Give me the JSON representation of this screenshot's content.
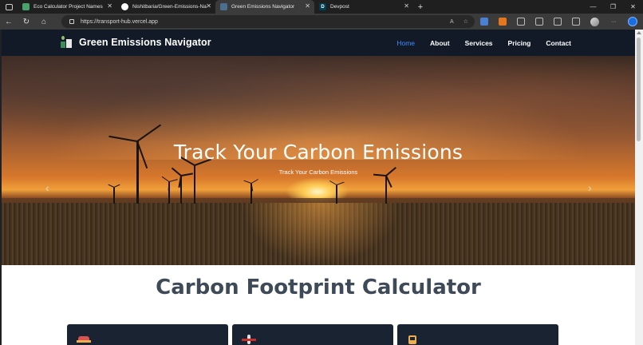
{
  "browser": {
    "tabs": [
      {
        "title": "Eco Calculator Project Names",
        "favicon_color": "#4aa26b"
      },
      {
        "title": "Nishitbaria/Green-Emissions-Na",
        "favicon_color": "#ffffff"
      },
      {
        "title": "Green Emissions Navigator",
        "favicon_color": "#4b6f8f"
      },
      {
        "title": "Devpost",
        "favicon_color": "#003e54",
        "favicon_letter": "D"
      }
    ],
    "active_tab": 2,
    "url": "https://transport-hub.vercel.app"
  },
  "site": {
    "brand": "Green Emissions Navigator",
    "nav": [
      {
        "label": "Home",
        "active": true
      },
      {
        "label": "About",
        "active": false
      },
      {
        "label": "Services",
        "active": false
      },
      {
        "label": "Pricing",
        "active": false
      },
      {
        "label": "Contact",
        "active": false
      }
    ],
    "hero": {
      "title": "Track Your Carbon Emissions",
      "subtitle": "Track Your Carbon Emissions",
      "prev_icon": "chevron-left-icon",
      "next_icon": "chevron-right-icon",
      "slide_count": 3
    },
    "section_title": "Carbon Footprint Calculator",
    "cards": [
      {
        "icon": "car-icon"
      },
      {
        "icon": "plane-icon"
      },
      {
        "icon": "train-icon"
      }
    ]
  },
  "colors": {
    "navbar_bg": "#121a28",
    "nav_active": "#3d8bff",
    "section_title": "#3f4a58",
    "card_bg": "#1a2332"
  }
}
